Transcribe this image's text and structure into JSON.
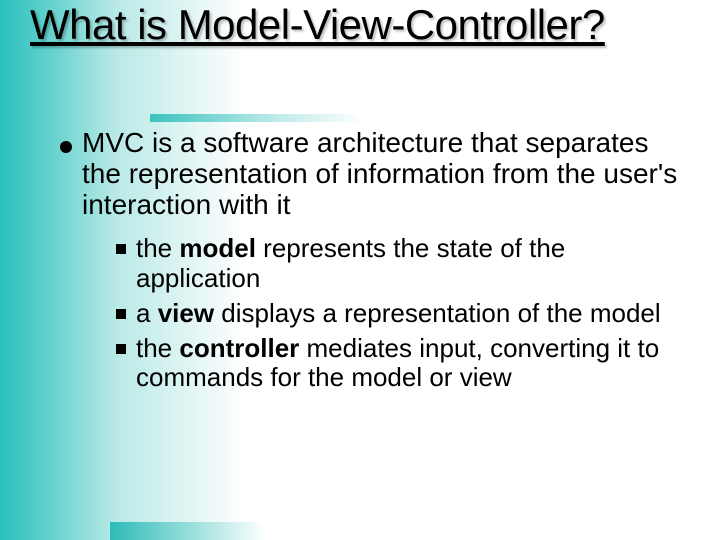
{
  "title": "What is Model-View-Controller?",
  "bullets": {
    "main": "MVC is a software architecture that separates the representation of information from the user's interaction with it",
    "sub1_pre": "the ",
    "sub1_b": "model",
    "sub1_post": " represents the state of the application",
    "sub2_pre": "a ",
    "sub2_b": "view",
    "sub2_post": " displays a representation of the model",
    "sub3_pre": "the ",
    "sub3_b": "controller",
    "sub3_post": " mediates input, converting it to commands for the model or view"
  }
}
